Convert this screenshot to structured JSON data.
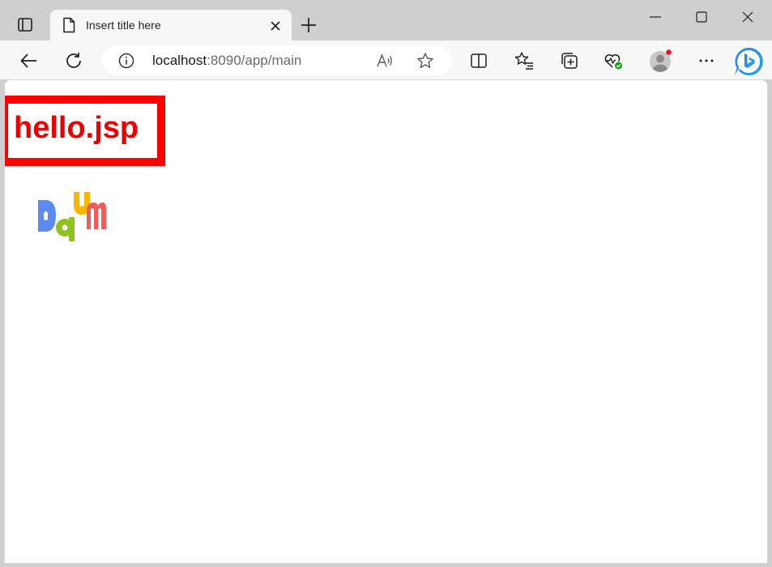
{
  "tab": {
    "title": "Insert title here"
  },
  "address_bar": {
    "url_host": "localhost",
    "url_rest": ":8090/app/main"
  },
  "page": {
    "heading": "hello.jsp",
    "logo_text": "Daum"
  },
  "colors": {
    "heading_color": "#ee0000",
    "box_border": "#ff0000",
    "logo_blue": "#5b8bf0",
    "logo_green": "#8dc21f",
    "logo_yellow": "#f7b600",
    "logo_red": "#f25b5b"
  },
  "icons": [
    "tab-actions-icon",
    "page-icon",
    "close-icon",
    "plus-icon",
    "minimize-icon",
    "maximize-icon",
    "window-close-icon",
    "back-arrow-icon",
    "refresh-icon",
    "info-icon",
    "read-aloud-icon",
    "star-icon",
    "split-screen-icon",
    "favorites-icon",
    "collections-icon",
    "browser-essentials-icon",
    "profile-avatar",
    "more-icon",
    "copilot-icon"
  ]
}
